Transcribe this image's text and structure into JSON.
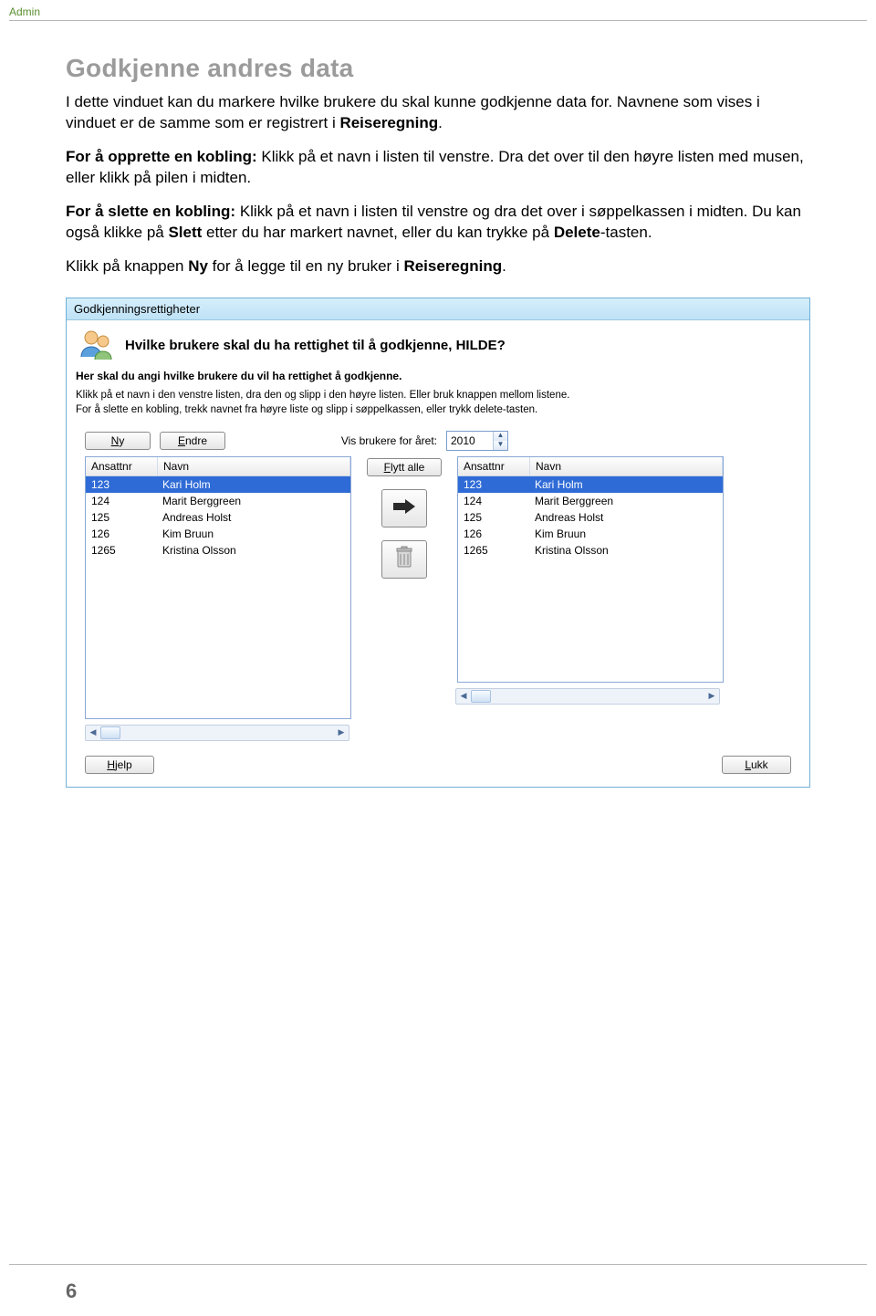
{
  "header_label": "Admin",
  "section_title": "Godkjenne andres data",
  "paragraphs": {
    "p1a": "I dette vinduet kan du markere hvilke brukere du skal kunne godkjenne data for. Navnene som vises i vinduet er de samme som er registrert i ",
    "p1b": "Reiseregning",
    "p1c": ".",
    "p2a": "For å opprette en kobling:",
    "p2b": " Klikk på et navn i listen til venstre. Dra det over til den høyre listen med musen, eller klikk på pilen i midten.",
    "p3a": "For å slette en kobling:",
    "p3b": " Klikk på et navn i listen til venstre og dra det over i søppelkassen i midten. Du kan også klikke på ",
    "p3c": "Slett",
    "p3d": " etter du har markert navnet, eller du kan trykke på ",
    "p3e": "Delete",
    "p3f": "-tasten.",
    "p4a": "Klikk på knappen ",
    "p4b": "Ny",
    "p4c": " for å legge til en ny bruker i ",
    "p4d": "Reiseregning",
    "p4e": "."
  },
  "screenshot": {
    "title": "Godkjenningsrettigheter",
    "hero": "Hvilke brukere skal du ha rettighet til å godkjenne, HILDE?",
    "sub1": "Her skal du angi hvilke brukere du vil ha rettighet å godkjenne.",
    "sub2_line1": "Klikk på et navn i den venstre listen, dra den og slipp i den høyre listen. Eller bruk knappen mellom listene.",
    "sub2_line2": "For å slette en kobling, trekk navnet fra høyre liste og slipp i søppelkassen, eller trykk delete-tasten.",
    "buttons": {
      "ny": "Ny",
      "endre": "Endre",
      "flytt_alle": "Flytt alle",
      "hjelp": "Hjelp",
      "lukk": "Lukk"
    },
    "year_label": "Vis brukere for året:",
    "year_value": "2010",
    "columns": {
      "ansattnr": "Ansattnr",
      "navn": "Navn"
    },
    "left_list": [
      {
        "nr": "123",
        "navn": "Kari Holm",
        "selected": true
      },
      {
        "nr": "124",
        "navn": "Marit Berggreen"
      },
      {
        "nr": "125",
        "navn": "Andreas Holst"
      },
      {
        "nr": "126",
        "navn": "Kim Bruun"
      },
      {
        "nr": "1265",
        "navn": "Kristina Olsson"
      }
    ],
    "right_list": [
      {
        "nr": "123",
        "navn": "Kari Holm",
        "selected": true
      },
      {
        "nr": "124",
        "navn": "Marit Berggreen"
      },
      {
        "nr": "125",
        "navn": "Andreas Holst"
      },
      {
        "nr": "126",
        "navn": "Kim Bruun"
      },
      {
        "nr": "1265",
        "navn": "Kristina Olsson"
      }
    ]
  },
  "page_number": "6"
}
